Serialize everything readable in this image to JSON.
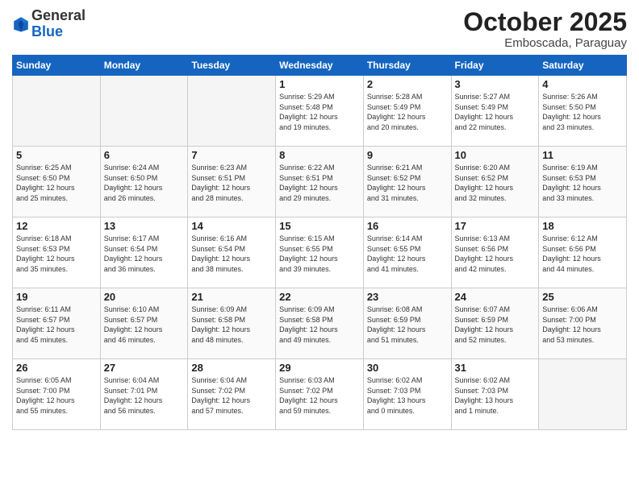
{
  "header": {
    "logo_general": "General",
    "logo_blue": "Blue",
    "month": "October 2025",
    "location": "Emboscada, Paraguay"
  },
  "weekdays": [
    "Sunday",
    "Monday",
    "Tuesday",
    "Wednesday",
    "Thursday",
    "Friday",
    "Saturday"
  ],
  "weeks": [
    [
      {
        "day": "",
        "info": ""
      },
      {
        "day": "",
        "info": ""
      },
      {
        "day": "",
        "info": ""
      },
      {
        "day": "1",
        "info": "Sunrise: 5:29 AM\nSunset: 5:48 PM\nDaylight: 12 hours\nand 19 minutes."
      },
      {
        "day": "2",
        "info": "Sunrise: 5:28 AM\nSunset: 5:49 PM\nDaylight: 12 hours\nand 20 minutes."
      },
      {
        "day": "3",
        "info": "Sunrise: 5:27 AM\nSunset: 5:49 PM\nDaylight: 12 hours\nand 22 minutes."
      },
      {
        "day": "4",
        "info": "Sunrise: 5:26 AM\nSunset: 5:50 PM\nDaylight: 12 hours\nand 23 minutes."
      }
    ],
    [
      {
        "day": "5",
        "info": "Sunrise: 6:25 AM\nSunset: 6:50 PM\nDaylight: 12 hours\nand 25 minutes."
      },
      {
        "day": "6",
        "info": "Sunrise: 6:24 AM\nSunset: 6:50 PM\nDaylight: 12 hours\nand 26 minutes."
      },
      {
        "day": "7",
        "info": "Sunrise: 6:23 AM\nSunset: 6:51 PM\nDaylight: 12 hours\nand 28 minutes."
      },
      {
        "day": "8",
        "info": "Sunrise: 6:22 AM\nSunset: 6:51 PM\nDaylight: 12 hours\nand 29 minutes."
      },
      {
        "day": "9",
        "info": "Sunrise: 6:21 AM\nSunset: 6:52 PM\nDaylight: 12 hours\nand 31 minutes."
      },
      {
        "day": "10",
        "info": "Sunrise: 6:20 AM\nSunset: 6:52 PM\nDaylight: 12 hours\nand 32 minutes."
      },
      {
        "day": "11",
        "info": "Sunrise: 6:19 AM\nSunset: 6:53 PM\nDaylight: 12 hours\nand 33 minutes."
      }
    ],
    [
      {
        "day": "12",
        "info": "Sunrise: 6:18 AM\nSunset: 6:53 PM\nDaylight: 12 hours\nand 35 minutes."
      },
      {
        "day": "13",
        "info": "Sunrise: 6:17 AM\nSunset: 6:54 PM\nDaylight: 12 hours\nand 36 minutes."
      },
      {
        "day": "14",
        "info": "Sunrise: 6:16 AM\nSunset: 6:54 PM\nDaylight: 12 hours\nand 38 minutes."
      },
      {
        "day": "15",
        "info": "Sunrise: 6:15 AM\nSunset: 6:55 PM\nDaylight: 12 hours\nand 39 minutes."
      },
      {
        "day": "16",
        "info": "Sunrise: 6:14 AM\nSunset: 6:55 PM\nDaylight: 12 hours\nand 41 minutes."
      },
      {
        "day": "17",
        "info": "Sunrise: 6:13 AM\nSunset: 6:56 PM\nDaylight: 12 hours\nand 42 minutes."
      },
      {
        "day": "18",
        "info": "Sunrise: 6:12 AM\nSunset: 6:56 PM\nDaylight: 12 hours\nand 44 minutes."
      }
    ],
    [
      {
        "day": "19",
        "info": "Sunrise: 6:11 AM\nSunset: 6:57 PM\nDaylight: 12 hours\nand 45 minutes."
      },
      {
        "day": "20",
        "info": "Sunrise: 6:10 AM\nSunset: 6:57 PM\nDaylight: 12 hours\nand 46 minutes."
      },
      {
        "day": "21",
        "info": "Sunrise: 6:09 AM\nSunset: 6:58 PM\nDaylight: 12 hours\nand 48 minutes."
      },
      {
        "day": "22",
        "info": "Sunrise: 6:09 AM\nSunset: 6:58 PM\nDaylight: 12 hours\nand 49 minutes."
      },
      {
        "day": "23",
        "info": "Sunrise: 6:08 AM\nSunset: 6:59 PM\nDaylight: 12 hours\nand 51 minutes."
      },
      {
        "day": "24",
        "info": "Sunrise: 6:07 AM\nSunset: 6:59 PM\nDaylight: 12 hours\nand 52 minutes."
      },
      {
        "day": "25",
        "info": "Sunrise: 6:06 AM\nSunset: 7:00 PM\nDaylight: 12 hours\nand 53 minutes."
      }
    ],
    [
      {
        "day": "26",
        "info": "Sunrise: 6:05 AM\nSunset: 7:00 PM\nDaylight: 12 hours\nand 55 minutes."
      },
      {
        "day": "27",
        "info": "Sunrise: 6:04 AM\nSunset: 7:01 PM\nDaylight: 12 hours\nand 56 minutes."
      },
      {
        "day": "28",
        "info": "Sunrise: 6:04 AM\nSunset: 7:02 PM\nDaylight: 12 hours\nand 57 minutes."
      },
      {
        "day": "29",
        "info": "Sunrise: 6:03 AM\nSunset: 7:02 PM\nDaylight: 12 hours\nand 59 minutes."
      },
      {
        "day": "30",
        "info": "Sunrise: 6:02 AM\nSunset: 7:03 PM\nDaylight: 13 hours\nand 0 minutes."
      },
      {
        "day": "31",
        "info": "Sunrise: 6:02 AM\nSunset: 7:03 PM\nDaylight: 13 hours\nand 1 minute."
      },
      {
        "day": "",
        "info": ""
      }
    ]
  ]
}
